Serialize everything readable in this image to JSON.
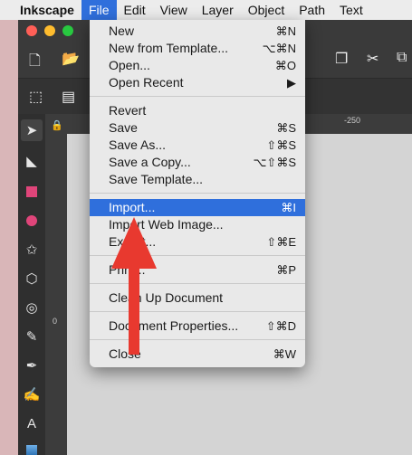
{
  "menubar": {
    "apple_icon": "apple-logo-icon",
    "app_name": "Inkscape",
    "items": [
      "File",
      "Edit",
      "View",
      "Layer",
      "Object",
      "Path",
      "Text"
    ]
  },
  "file_menu": {
    "groups": [
      [
        {
          "label": "New",
          "shortcut": "⌘N"
        },
        {
          "label": "New from Template...",
          "shortcut": "⌥⌘N"
        },
        {
          "label": "Open...",
          "shortcut": "⌘O"
        },
        {
          "label": "Open Recent",
          "shortcut": "▶"
        }
      ],
      [
        {
          "label": "Revert",
          "shortcut": ""
        },
        {
          "label": "Save",
          "shortcut": "⌘S"
        },
        {
          "label": "Save As...",
          "shortcut": "⇧⌘S"
        },
        {
          "label": "Save a Copy...",
          "shortcut": "⌥⇧⌘S"
        },
        {
          "label": "Save Template...",
          "shortcut": ""
        }
      ],
      [
        {
          "label": "Import...",
          "shortcut": "⌘I",
          "highlighted": true
        },
        {
          "label": "Import Web Image...",
          "shortcut": ""
        },
        {
          "label": "Export...",
          "shortcut": "⇧⌘E"
        }
      ],
      [
        {
          "label": "Print...",
          "shortcut": "⌘P"
        }
      ],
      [
        {
          "label": "Clean Up Document",
          "shortcut": ""
        }
      ],
      [
        {
          "label": "Document Properties...",
          "shortcut": "⇧⌘D"
        }
      ],
      [
        {
          "label": "Close",
          "shortcut": "⌘W"
        }
      ]
    ]
  },
  "rulers": {
    "h_label": "-250",
    "v_label": "0"
  },
  "colors": {
    "menu_highlight": "#2f6fdc",
    "annotation_arrow": "#e8392f"
  }
}
